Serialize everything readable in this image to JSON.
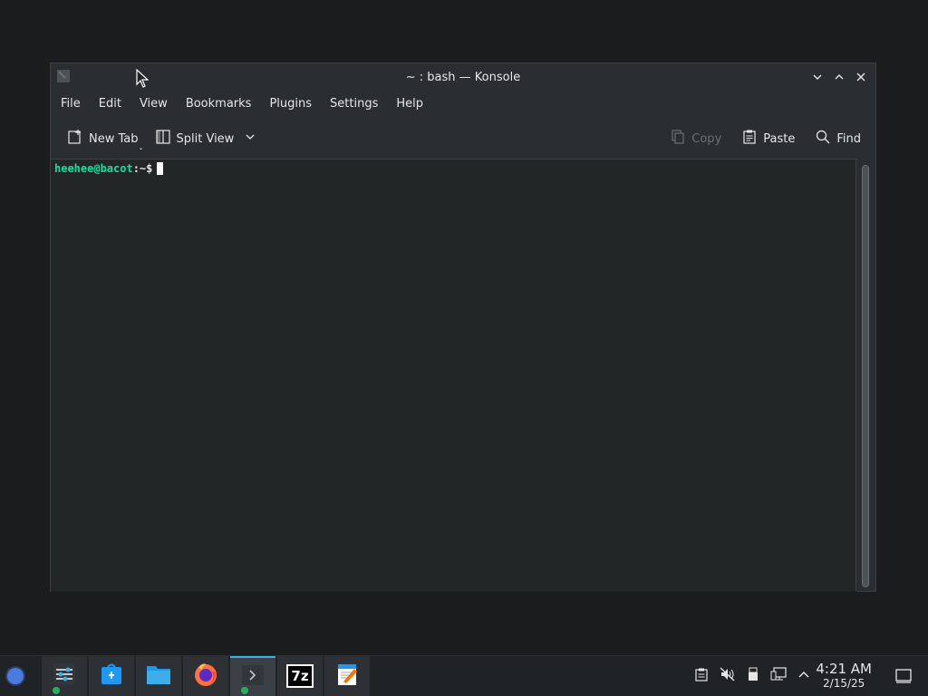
{
  "window": {
    "title": "~ : bash — Konsole"
  },
  "menubar": {
    "items": [
      "File",
      "Edit",
      "View",
      "Bookmarks",
      "Plugins",
      "Settings",
      "Help"
    ]
  },
  "toolbar": {
    "new_tab": "New Tab",
    "split_view": "Split View",
    "copy": "Copy",
    "paste": "Paste",
    "find": "Find"
  },
  "terminal": {
    "user_host": "heehee@bacot",
    "path": ":~$"
  },
  "taskbar": {
    "tasks": [
      "system-settings-icon",
      "discover-store-icon",
      "file-manager-icon",
      "firefox-icon",
      "konsole-icon",
      "7zip-icon",
      "text-editor-icon"
    ],
    "seven_zip_label": "7z",
    "time": "4:21 AM",
    "date": "2/15/25"
  },
  "colors": {
    "accent": "#3daee9",
    "prompt_green": "#1cdc9a"
  }
}
